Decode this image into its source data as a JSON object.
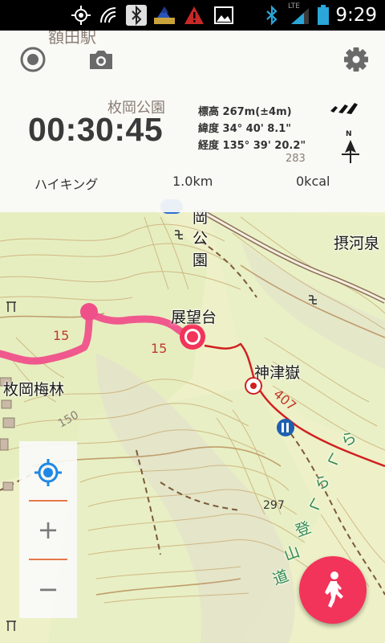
{
  "status_bar": {
    "time": "9:29",
    "network_label": "LTE",
    "icons": [
      "gps-icon",
      "nfc-icon",
      "bluetooth-icon",
      "weather-icon",
      "alert-icon",
      "image-icon",
      "bluetooth-icon",
      "signal-icon",
      "battery-icon"
    ]
  },
  "panel": {
    "elapsed_time": "00:30:45",
    "altitude": "標高 267m(±4m)",
    "latitude": "緯度 34° 40' 8.1\"",
    "longitude": "経度 135° 39' 20.2\"",
    "compass_letter": "N",
    "activity": "ハイキング",
    "distance": "1.0km",
    "calories": "0kcal",
    "icons": [
      "record-icon",
      "camera-icon",
      "settings-icon",
      "gps-signal-icon",
      "compass-icon"
    ]
  },
  "map": {
    "labels": {
      "plum_grove": "枚岡梅林",
      "observatory": "展望台",
      "shrine_peak": "神津嶽",
      "park_top": "枚岡公園",
      "settsu": "摂河泉",
      "park_vertical_1": "岡",
      "park_vertical_2": "公",
      "park_vertical_3": "園",
      "station": "額田駅",
      "route_num_1": "15",
      "route_num_2": "15",
      "road_407": "407",
      "elev_297": "297",
      "elev_150": "150",
      "elev_283": "283",
      "trail_1": "ら",
      "trail_2": "く",
      "trail_3": "ら",
      "trail_4": "く",
      "trail_5": "登",
      "trail_6": "山",
      "trail_7": "道"
    },
    "route_color": "#f0508a",
    "road_color": "#d02020"
  },
  "zoom": {
    "zoom_in_label": "+",
    "zoom_out_label": "−"
  },
  "colors": {
    "accent": "#f2335a",
    "locate_blue": "#1e88e5",
    "separator": "#e6784a"
  }
}
